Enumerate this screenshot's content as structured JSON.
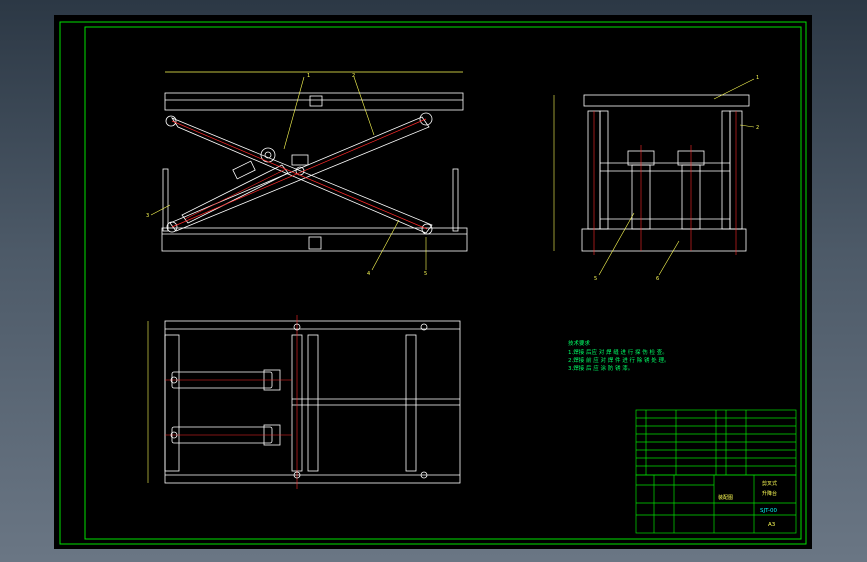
{
  "drawing": {
    "colors": {
      "background": "#000000",
      "frame": "#00e000",
      "geometry": "#ffffff",
      "centerline": "#ff2a2a",
      "annotation": "#ffff55",
      "cyan": "#00ffff"
    },
    "dimensions": {
      "front_width": "",
      "front_height": "",
      "side_height": "",
      "plan_height": ""
    },
    "balloons": [
      "1",
      "2",
      "3",
      "4",
      "5",
      "6"
    ],
    "notes": {
      "title": "技术要求",
      "lines": [
        "1.焊接 后应 对 焊 缝 进 行 探 伤 检 查。",
        "2.焊接 前 应 对 焊 件 进 行 除 锈 处 理。",
        "3.焊接 后 应 涂 防 锈 漆。"
      ]
    },
    "title_block": {
      "drawing_no": "SJT-00",
      "sheet_size": "A3",
      "parts_label": "剪叉式",
      "assembly_label": "升降台",
      "school": "装配图"
    }
  }
}
